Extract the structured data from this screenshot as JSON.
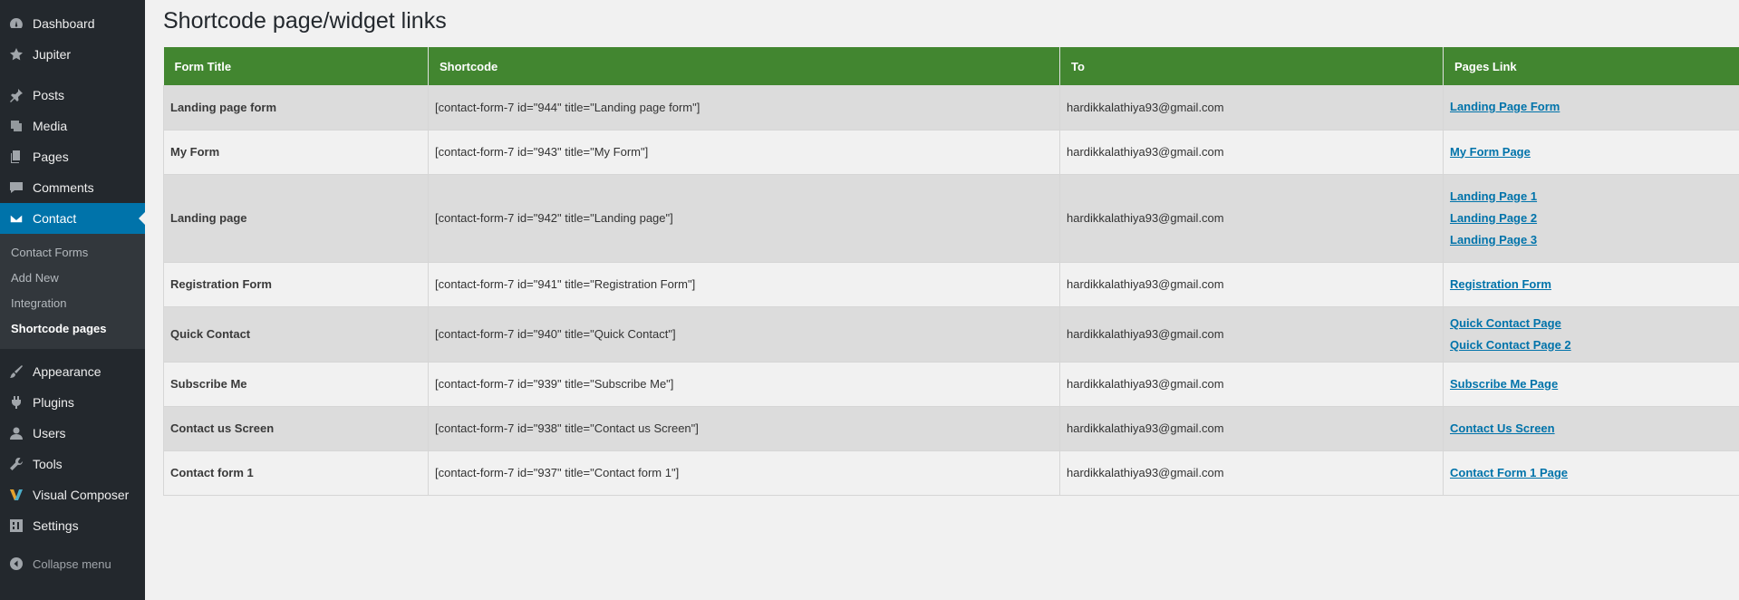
{
  "sidebar": {
    "items_top": [
      {
        "label": "Dashboard",
        "icon": "dashboard-icon"
      },
      {
        "label": "Jupiter",
        "icon": "star-icon"
      }
    ],
    "items_main": [
      {
        "label": "Posts",
        "icon": "pin-icon"
      },
      {
        "label": "Media",
        "icon": "media-icon"
      },
      {
        "label": "Pages",
        "icon": "pages-icon"
      },
      {
        "label": "Comments",
        "icon": "comment-icon"
      },
      {
        "label": "Contact",
        "icon": "mail-icon"
      }
    ],
    "submenu": [
      {
        "label": "Contact Forms"
      },
      {
        "label": "Add New"
      },
      {
        "label": "Integration"
      },
      {
        "label": "Shortcode pages"
      }
    ],
    "items_lower": [
      {
        "label": "Appearance",
        "icon": "brush-icon"
      },
      {
        "label": "Plugins",
        "icon": "plugin-icon"
      },
      {
        "label": "Users",
        "icon": "user-icon"
      },
      {
        "label": "Tools",
        "icon": "wrench-icon"
      },
      {
        "label": "Visual Composer",
        "icon": "vc-icon"
      },
      {
        "label": "Settings",
        "icon": "settings-icon"
      }
    ],
    "collapse_label": "Collapse menu"
  },
  "page": {
    "title": "Shortcode page/widget links"
  },
  "table": {
    "headers": [
      "Form Title",
      "Shortcode",
      "To",
      "Pages Link"
    ],
    "rows": [
      {
        "title": "Landing page form",
        "shortcode": "[contact-form-7 id=\"944\" title=\"Landing page form\"]",
        "to": "hardikkalathiya93@gmail.com",
        "links": [
          "Landing Page Form"
        ]
      },
      {
        "title": "My Form",
        "shortcode": "[contact-form-7 id=\"943\" title=\"My Form\"]",
        "to": "hardikkalathiya93@gmail.com",
        "links": [
          "My Form Page"
        ]
      },
      {
        "title": "Landing page",
        "shortcode": "[contact-form-7 id=\"942\" title=\"Landing page\"]",
        "to": "hardikkalathiya93@gmail.com",
        "links": [
          "Landing Page 1",
          "Landing Page 2",
          "Landing Page 3"
        ]
      },
      {
        "title": "Registration Form",
        "shortcode": "[contact-form-7 id=\"941\" title=\"Registration Form\"]",
        "to": "hardikkalathiya93@gmail.com",
        "links": [
          "Registration Form"
        ]
      },
      {
        "title": "Quick Contact",
        "shortcode": "[contact-form-7 id=\"940\" title=\"Quick Contact\"]",
        "to": "hardikkalathiya93@gmail.com",
        "links": [
          "Quick Contact Page",
          "Quick Contact Page 2"
        ]
      },
      {
        "title": "Subscribe Me",
        "shortcode": "[contact-form-7 id=\"939\" title=\"Subscribe Me\"]",
        "to": "hardikkalathiya93@gmail.com",
        "links": [
          "Subscribe Me Page"
        ]
      },
      {
        "title": "Contact us Screen",
        "shortcode": "[contact-form-7 id=\"938\" title=\"Contact us Screen\"]",
        "to": "hardikkalathiya93@gmail.com",
        "links": [
          "Contact Us Screen"
        ]
      },
      {
        "title": "Contact form 1",
        "shortcode": "[contact-form-7 id=\"937\" title=\"Contact form 1\"]",
        "to": "hardikkalathiya93@gmail.com",
        "links": [
          "Contact Form 1 Page"
        ]
      }
    ]
  },
  "colors": {
    "sidebar_bg": "#23282d",
    "submenu_bg": "#32373c",
    "active_bg": "#0073aa",
    "table_header_bg": "#428630",
    "link": "#0073aa",
    "row_shade": "#dcdcdc",
    "page_bg": "#f1f1f1"
  }
}
